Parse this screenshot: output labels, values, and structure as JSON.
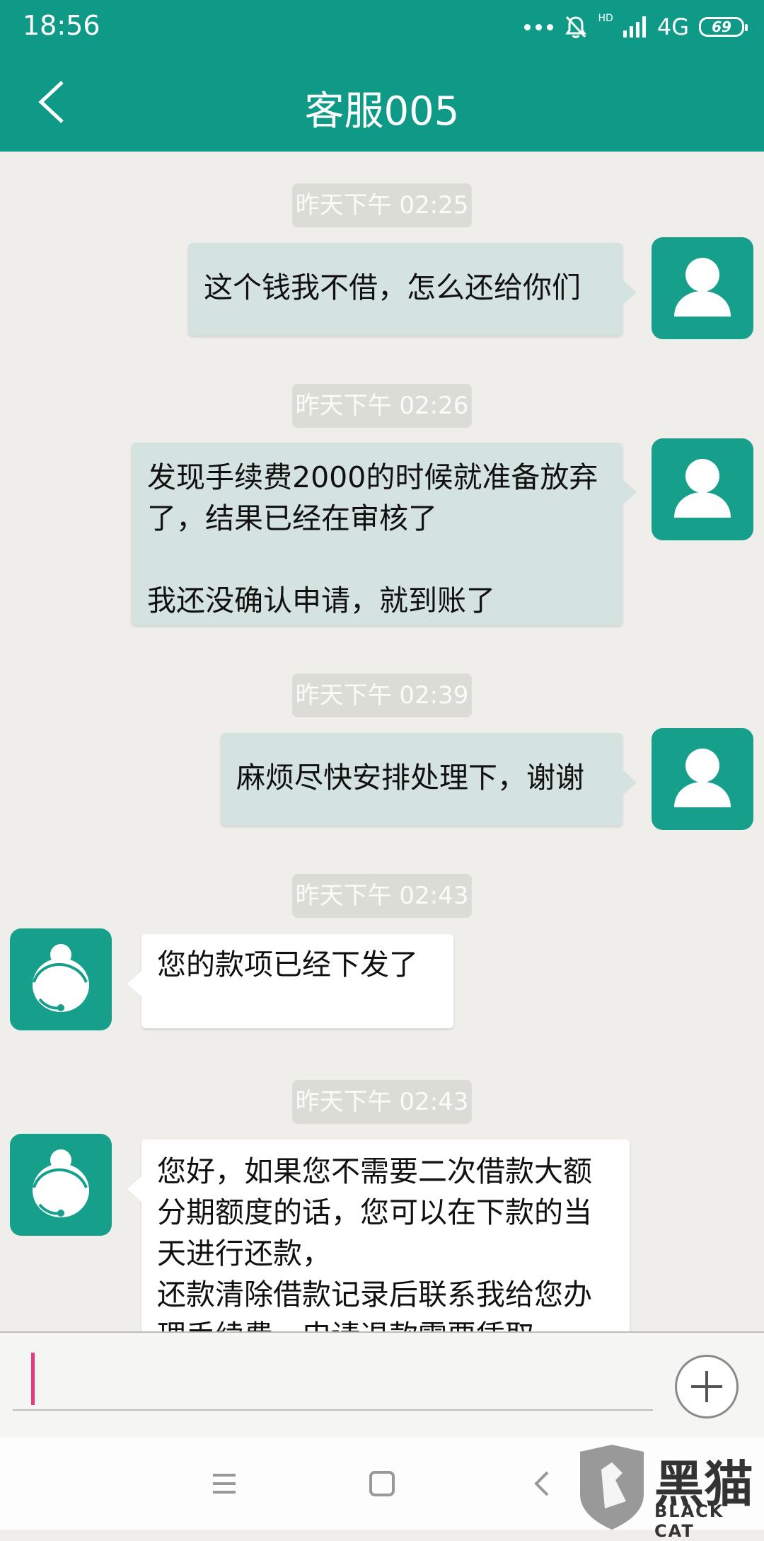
{
  "status_bar": {
    "time": "18:56",
    "network": "4G",
    "hd_label": "HD",
    "battery": "69"
  },
  "header": {
    "title": "客服005",
    "color": "#0f9a88"
  },
  "messages": [
    {
      "timestamp": "昨天下午 02:25",
      "sender": "user",
      "text": "这个钱我不借，怎么还给你们"
    },
    {
      "timestamp": "昨天下午 02:26",
      "sender": "user",
      "text": "发现手续费2000的时候就准备放弃了，结果已经在审核了\n\n我还没确认申请，就到账了"
    },
    {
      "timestamp": "昨天下午 02:39",
      "sender": "user",
      "text": "麻烦尽快安排处理下，谢谢"
    },
    {
      "timestamp": "昨天下午 02:43",
      "sender": "agent",
      "text": "您的款项已经下发了"
    },
    {
      "timestamp": "昨天下午 02:43",
      "sender": "agent",
      "text": "您好，如果您不需要二次借款大额分期额度的话，您可以在下款的当天进行还款，\n还款清除借款记录后联系我给您办理手续费，申请退款需要凭取"
    }
  ],
  "input": {
    "value": "",
    "placeholder": ""
  },
  "icons": {
    "back": "back-arrow-icon",
    "user_avatar": "user-avatar-icon",
    "agent_avatar": "customer-service-agent-icon",
    "add": "plus-icon",
    "nav_menu": "menu-icon",
    "nav_home": "home-icon",
    "nav_back": "back-icon"
  },
  "watermark": {
    "text_cn": "黑猫",
    "text_en": "BLACK CAT"
  }
}
